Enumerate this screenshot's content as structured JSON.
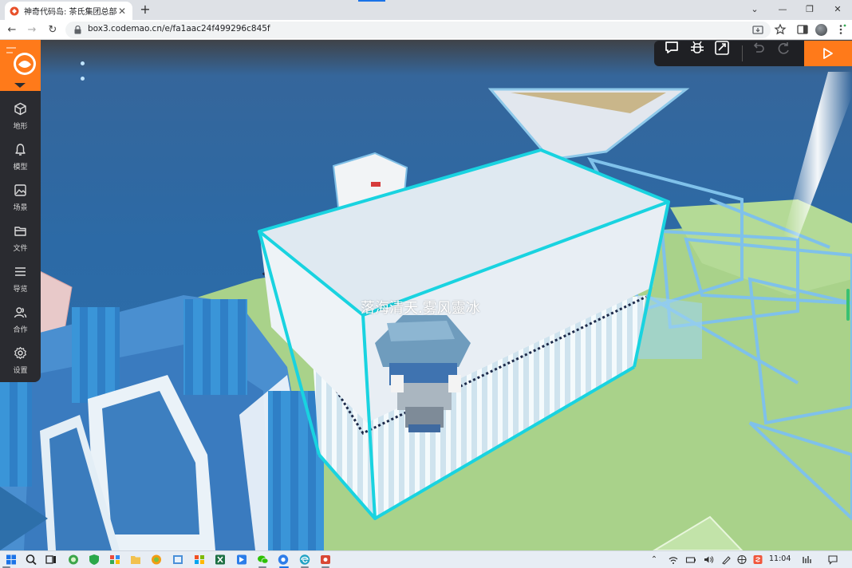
{
  "browser": {
    "tab_title": "神奇代码岛: 茶氏集团总部",
    "tab_close": "✕",
    "new_tab": "+",
    "url": "box3.codemao.cn/e/fa1aac24f499296c845f",
    "window_controls": {
      "dropdown": "⌄",
      "minimize": "—",
      "restore": "❐",
      "close": "✕"
    },
    "nav": {
      "back": "←",
      "forward": "→",
      "reload": "↻"
    }
  },
  "sidebar": {
    "items": [
      {
        "label": "地形",
        "icon": "cube-icon"
      },
      {
        "label": "模型",
        "icon": "bell-icon"
      },
      {
        "label": "场景",
        "icon": "image-icon"
      },
      {
        "label": "文件",
        "icon": "folder-icon"
      },
      {
        "label": "导览",
        "icon": "list-icon"
      },
      {
        "label": "合作",
        "icon": "users-icon"
      },
      {
        "label": "设置",
        "icon": "gear-icon"
      }
    ]
  },
  "editor_toolbar": {
    "buttons": [
      "chat-icon",
      "bug-icon",
      "expand-icon",
      "undo-icon",
      "redo-icon",
      "play-icon"
    ]
  },
  "scene": {
    "player_name": "落海清天.雾风靈冰",
    "colors": {
      "water": "#2f6da7",
      "ground": "#a9d28a",
      "highlight": "#19d3e0",
      "accent": "#ff7a1a"
    }
  },
  "taskbar": {
    "clock": "11:04"
  }
}
